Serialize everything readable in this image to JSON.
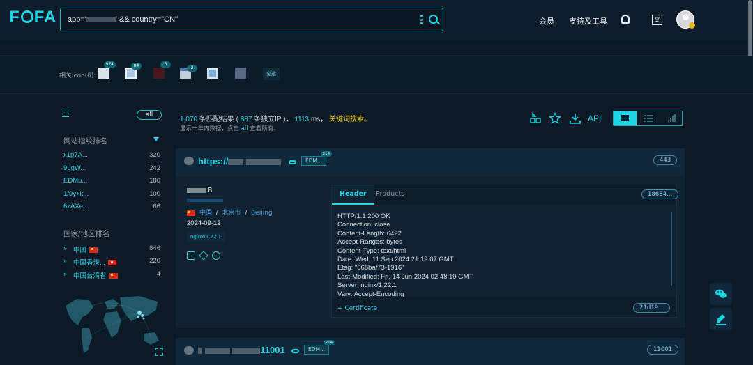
{
  "brand": {
    "logo_text": "FOFA"
  },
  "search": {
    "query_prefix": "app=",
    "query_suffix": "' && country=\"CN\""
  },
  "nav": {
    "member": "会员",
    "tools": "支持及工具"
  },
  "icons_row": {
    "label": "相关icon(6):",
    "counts": [
      "974",
      "84",
      "3",
      "2",
      "",
      ""
    ],
    "select_all": "全选"
  },
  "sidebar": {
    "all_label": "all",
    "fingerprint_title": "网站指纹排名",
    "fingerprints": [
      {
        "name": "x1p7A...",
        "count": "320"
      },
      {
        "name": "9LgW...",
        "count": "242"
      },
      {
        "name": "EDMu...",
        "count": "180"
      },
      {
        "name": "1/9y+k...",
        "count": "100"
      },
      {
        "name": "6zAXe...",
        "count": "66"
      }
    ],
    "country_title": "国家/地区排名",
    "countries": [
      {
        "name": "中国",
        "count": "846"
      },
      {
        "name": "中国香港...",
        "count": "220"
      },
      {
        "name": "中国台湾省",
        "count": "4"
      }
    ]
  },
  "stats": {
    "matches": "1,070",
    "matches_label": "条匹配结果 (",
    "ips": "887",
    "ips_label": "条独立IP )，",
    "ms": "1113",
    "ms_label": "ms，",
    "keyword": "关键词搜索。",
    "note_prefix": "显示一年内数据，点击",
    "note_link": "all",
    "note_suffix": "查看所有。"
  },
  "toolbar": {
    "api": "API"
  },
  "result1": {
    "host_prefix": "https://",
    "edm": "EDM...",
    "edm_count": "214",
    "port": "443",
    "title_suffix": "B",
    "location": {
      "country": "中国",
      "region": "北京市",
      "city": "Beijing"
    },
    "date": "2024-09-12",
    "server_tag": "nginx/1.22.1",
    "tabs": {
      "header": "Header",
      "products": "Products"
    },
    "hash_top": "18684...",
    "header_lines": [
      "HTTP/1.1 200 OK",
      "Connection: close",
      "Content-Length: 6422",
      "Accept-Ranges: bytes",
      "Content-Type: text/html",
      "Date: Wed, 11 Sep 2024 21:19:07 GMT",
      "Etag: \"666baf73-1916\"",
      "Last-Modified: Fri, 14 Jun 2024 02:48:19 GMT",
      "Server: nginx/1.22.1",
      "Vary: Accept-Encoding"
    ],
    "certificate": "+ Certificate",
    "hash_bottom": "21d19..."
  },
  "result2": {
    "host_suffix": "11001",
    "edm": "EDM...",
    "edm_count": "214",
    "port": "11001"
  },
  "colors": {
    "accent": "#21d4e4",
    "background": "#0b1a26",
    "highlight": "#f3d11c"
  }
}
